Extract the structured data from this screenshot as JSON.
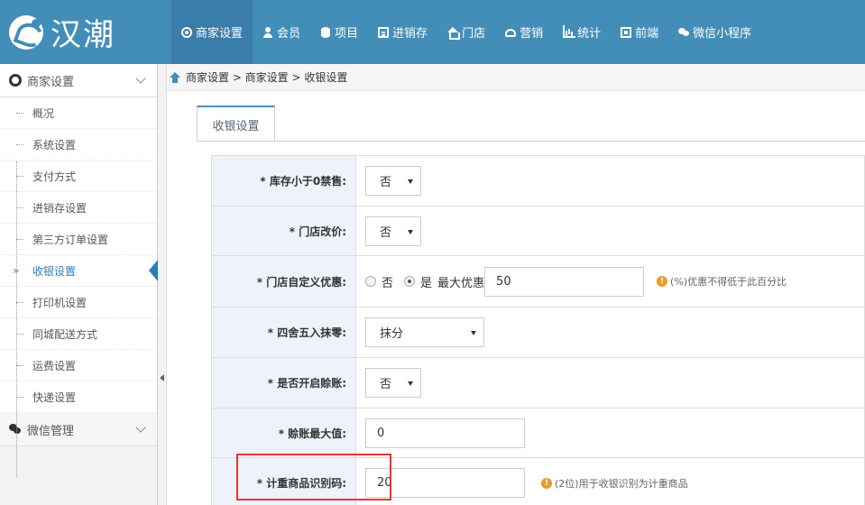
{
  "brand": {
    "name": "汉潮"
  },
  "nav": [
    {
      "label": "商家设置",
      "icon": "gear-icon",
      "active": true
    },
    {
      "label": "会员",
      "icon": "user-icon"
    },
    {
      "label": "项目",
      "icon": "stack-icon"
    },
    {
      "label": "进销存",
      "icon": "document-icon"
    },
    {
      "label": "门店",
      "icon": "home-icon"
    },
    {
      "label": "营销",
      "icon": "tag-icon"
    },
    {
      "label": "统计",
      "icon": "bar-chart-icon"
    },
    {
      "label": "前端",
      "icon": "screen-icon"
    },
    {
      "label": "微信小程序",
      "icon": "chat-icon"
    }
  ],
  "sidebar": {
    "group1": "商家设置",
    "items": [
      "概况",
      "系统设置",
      "支付方式",
      "进销存设置",
      "第三方订单设置",
      "收银设置",
      "打印机设置",
      "同城配送方式",
      "运费设置",
      "快递设置"
    ],
    "active_arrow": "»",
    "group2": "微信管理"
  },
  "breadcrumb": "商家设置 > 商家设置 > 收银设置",
  "tab": {
    "label": "收银设置"
  },
  "form": {
    "stock_label": "* 库存小于0禁售:",
    "stock_value": "否",
    "price_label": "* 门店改价:",
    "price_value": "否",
    "discount_label": "* 门店自定义优惠:",
    "discount_no": "否",
    "discount_yes": "是",
    "discount_max_label": "最大优惠",
    "discount_max_value": "50",
    "discount_hint": "(%)优惠不得低于此百分比",
    "round_label": "* 四舍五入抹零:",
    "round_value": "抹分",
    "credit_label": "* 是否开启赊账:",
    "credit_value": "否",
    "credit_max_label": "* 赊账最大值:",
    "credit_max_value": "0",
    "weigh_label": "* 计重商品识别码:",
    "weigh_value": "20",
    "weigh_hint": "(2位)用于收银识别为计重商品"
  },
  "colors": {
    "topbar": "#438eb9",
    "accent": "#2b7dbc",
    "label_bg": "#eef3fb",
    "highlight": "#ee3333",
    "warn": "#e99a28"
  }
}
